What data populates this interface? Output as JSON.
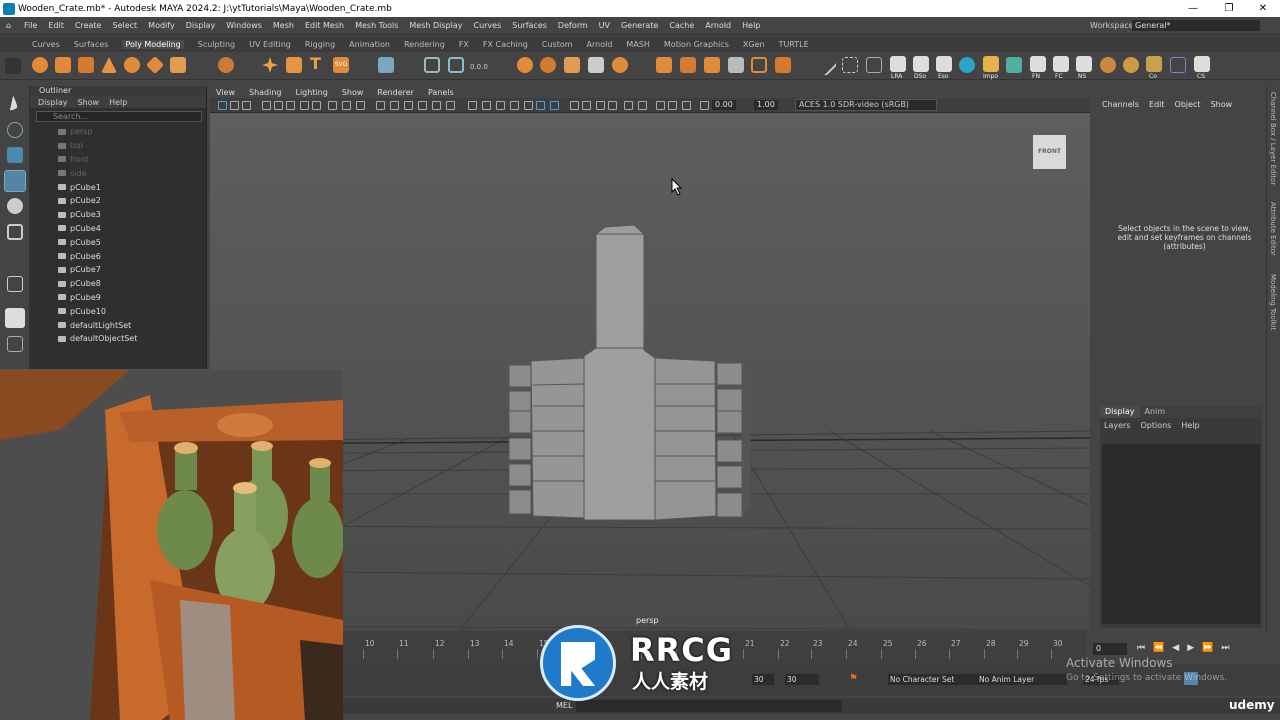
{
  "window": {
    "title": "Wooden_Crate.mb* - Autodesk MAYA 2024.2: J:\\ytTutorials\\Maya\\Wooden_Crate.mb",
    "minimize": "—",
    "maximize": "❐",
    "close": "✕"
  },
  "menu": [
    "File",
    "Edit",
    "Create",
    "Select",
    "Modify",
    "Display",
    "Windows",
    "Mesh",
    "Edit Mesh",
    "Mesh Tools",
    "Mesh Display",
    "Curves",
    "Surfaces",
    "Deform",
    "UV",
    "Generate",
    "Cache",
    "Arnold",
    "Help"
  ],
  "workspace": {
    "label": "Workspace:",
    "value": "General*"
  },
  "shelf_tabs": [
    "Curves",
    "Surfaces",
    "Poly Modeling",
    "Sculpting",
    "UV Editing",
    "Rigging",
    "Animation",
    "Rendering",
    "FX",
    "FX Caching",
    "Custom",
    "Arnold",
    "MASH",
    "Motion Graphics",
    "XGen",
    "TURTLE"
  ],
  "shelf_active": "Poly Modeling",
  "shelf_labels": [
    "0.0.0",
    "LRA",
    "DSo",
    "Eso",
    "Impo",
    "FN",
    "FC",
    "NS",
    "Co",
    "CS"
  ],
  "outliner": {
    "title": "Outliner",
    "menus": [
      "Display",
      "Show",
      "Help"
    ],
    "search_placeholder": "Search...",
    "items": [
      {
        "name": "persp",
        "dim": true
      },
      {
        "name": "top",
        "dim": true
      },
      {
        "name": "front",
        "dim": true
      },
      {
        "name": "side",
        "dim": true
      },
      {
        "name": "pCube1",
        "dim": false
      },
      {
        "name": "pCube2",
        "dim": false
      },
      {
        "name": "pCube3",
        "dim": false
      },
      {
        "name": "pCube4",
        "dim": false
      },
      {
        "name": "pCube5",
        "dim": false
      },
      {
        "name": "pCube6",
        "dim": false
      },
      {
        "name": "pCube7",
        "dim": false
      },
      {
        "name": "pCube8",
        "dim": false
      },
      {
        "name": "pCube9",
        "dim": false
      },
      {
        "name": "pCube10",
        "dim": false
      },
      {
        "name": "defaultLightSet",
        "dim": false
      },
      {
        "name": "defaultObjectSet",
        "dim": false
      }
    ]
  },
  "viewport": {
    "menus": [
      "View",
      "Shading",
      "Lighting",
      "Show",
      "Renderer",
      "Panels"
    ],
    "value1": "0.00",
    "value2": "1.00",
    "color_mgmt": "ACES 1.0 SDR-video (sRGB)",
    "view_cube": "FRONT",
    "camera": "persp"
  },
  "channel_box": {
    "menus": [
      "Channels",
      "Edit",
      "Object",
      "Show"
    ],
    "message": "Select objects in the scene to view, edit and set keyframes on channels (attributes)"
  },
  "layer_editor": {
    "tabs": [
      "Display",
      "Anim"
    ],
    "menus": [
      "Layers",
      "Options",
      "Help"
    ]
  },
  "side_tabs": [
    "Channel Box / Layer Editor",
    "Attribute Editor",
    "Modeling Toolkit"
  ],
  "timeline": {
    "ticks": [
      "10",
      "11",
      "12",
      "13",
      "14",
      "15",
      "",
      "",
      "",
      "",
      "",
      "21",
      "22",
      "23",
      "24",
      "25",
      "26",
      "27",
      "28",
      "29",
      "30"
    ],
    "current_frame": "0"
  },
  "range": {
    "start": "30",
    "end": "30",
    "character_set": "No Character Set",
    "anim_layer": "No Anim Layer",
    "fps": "24 fps"
  },
  "command_line": {
    "label": "MEL"
  },
  "overlay": {
    "activate_title": "Activate Windows",
    "activate_sub": "Go to Settings to activate Windows.",
    "udemy": "udemy",
    "logo_main": "RRCG",
    "logo_sub": "人人素材"
  },
  "colors": {
    "maya_bg": "#444444",
    "viewport_bg": "#5b5b5b",
    "accent": "#5285a6"
  }
}
